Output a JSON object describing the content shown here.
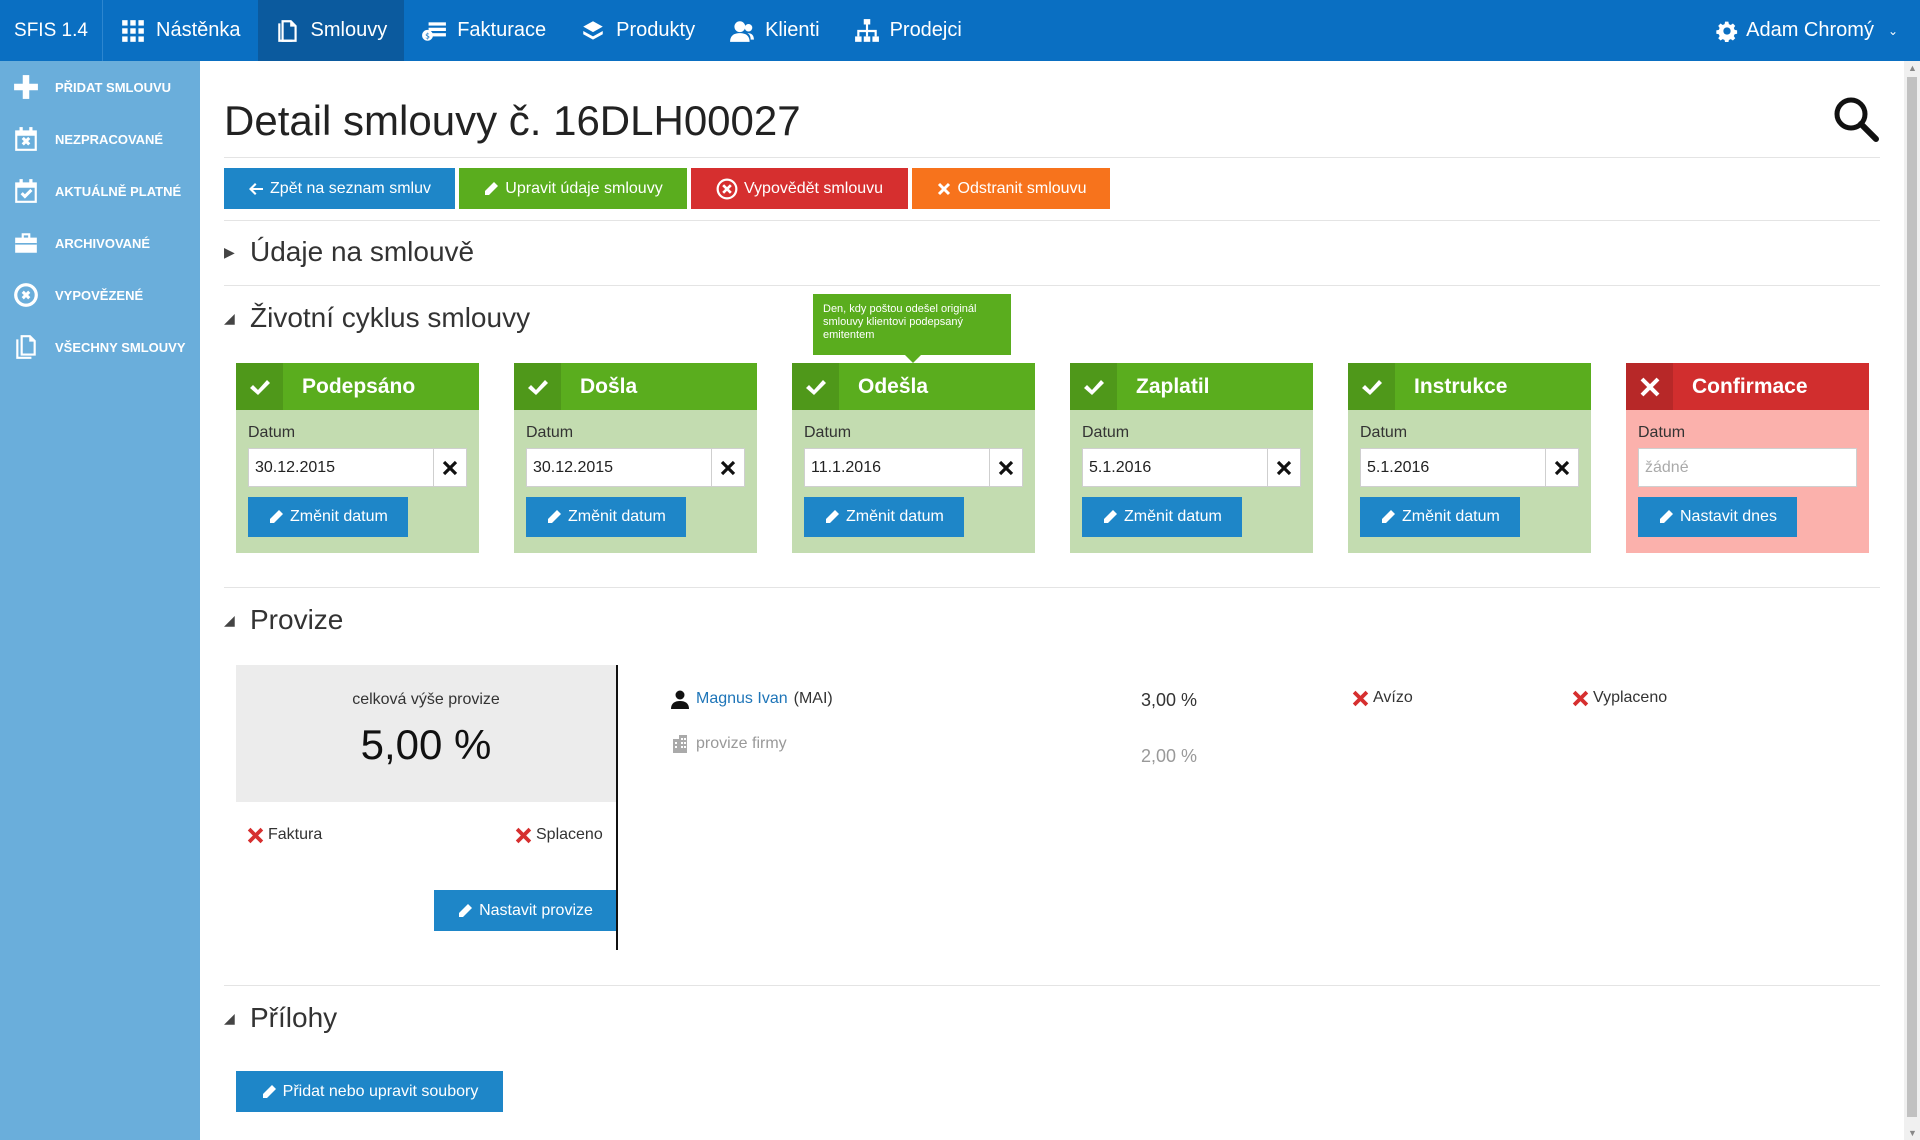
{
  "app": {
    "brand": "SFIS 1.4"
  },
  "nav": {
    "items": [
      {
        "label": "Nástěnka",
        "icon": "grid-icon"
      },
      {
        "label": "Smlouvy",
        "icon": "document-icon",
        "active": true
      },
      {
        "label": "Fakturace",
        "icon": "invoice-icon"
      },
      {
        "label": "Produkty",
        "icon": "layers-icon"
      },
      {
        "label": "Klienti",
        "icon": "users-icon"
      },
      {
        "label": "Prodejci",
        "icon": "hierarchy-icon"
      }
    ],
    "user": "Adam Chromý"
  },
  "sidebar": {
    "items": [
      {
        "label": "PŘIDAT SMLOUVU",
        "icon": "plus-icon"
      },
      {
        "label": "NEZPRACOVANÉ",
        "icon": "calendar-x-icon"
      },
      {
        "label": "AKTUÁLNĚ PLATNÉ",
        "icon": "calendar-check-icon"
      },
      {
        "label": "ARCHIVOVANÉ",
        "icon": "briefcase-icon"
      },
      {
        "label": "VYPOVĚZENÉ",
        "icon": "circle-x-icon"
      },
      {
        "label": "VŠECHNY SMLOUVY",
        "icon": "documents-icon"
      }
    ]
  },
  "page": {
    "title": "Detail smlouvy č. 16DLH00027",
    "buttons": {
      "back": "Zpět na seznam smluv",
      "edit": "Upravit údaje smlouvy",
      "terminate": "Vypovědět smlouvu",
      "delete": "Odstranit smlouvu"
    }
  },
  "sections": {
    "details": "Údaje na smlouvě",
    "lifecycle": "Životní cyklus smlouvy",
    "commission": "Provize",
    "attachments": "Přílohy"
  },
  "lifecycle": {
    "tooltip": "Den, kdy poštou odešel originál smlouvy klientovi podepsaný emitentem",
    "cards": [
      {
        "title": "Podepsáno",
        "date_label": "Datum",
        "date": "30.12.2015",
        "button": "Změnit datum",
        "status": "done"
      },
      {
        "title": "Došla",
        "date_label": "Datum",
        "date": "30.12.2015",
        "button": "Změnit datum",
        "status": "done"
      },
      {
        "title": "Odešla",
        "date_label": "Datum",
        "date": "11.1.2016",
        "button": "Změnit datum",
        "status": "done"
      },
      {
        "title": "Zaplatil",
        "date_label": "Datum",
        "date": "5.1.2016",
        "button": "Změnit datum",
        "status": "done"
      },
      {
        "title": "Instrukce",
        "date_label": "Datum",
        "date": "5.1.2016",
        "button": "Změnit datum",
        "status": "done"
      },
      {
        "title": "Confirmace",
        "date_label": "Datum",
        "placeholder": "žádné",
        "button": "Nastavit dnes",
        "status": "missing"
      }
    ]
  },
  "commission": {
    "total_label": "celková výše provize",
    "total_value": "5,00 %",
    "invoice_label": "Faktura",
    "paid_label": "Splaceno",
    "set_button": "Nastavit provize",
    "rows": [
      {
        "name": "Magnus Ivan",
        "code": "(MAI)",
        "value": "3,00 %",
        "advice": "Avízo",
        "payout": "Vyplaceno"
      },
      {
        "name": "provize firmy",
        "value": "2,00 %"
      }
    ]
  },
  "attachments": {
    "button": "Přidat nebo upravit soubory"
  },
  "colors": {
    "nav": "#0a6fc2",
    "sidebar": "#6aaedb",
    "green": "#5aad1e",
    "red": "#d62f2f",
    "orange": "#f7731c",
    "blue": "#1e86c8"
  }
}
